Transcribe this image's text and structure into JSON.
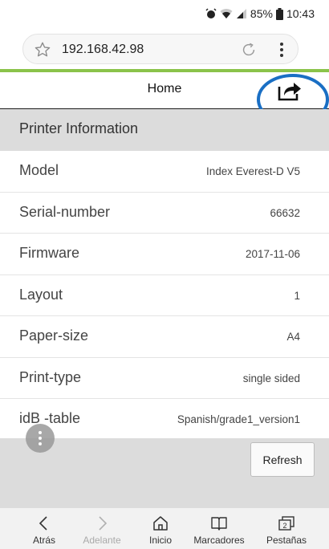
{
  "status_bar": {
    "battery": "85%",
    "time": "10:43"
  },
  "browser": {
    "url": "192.168.42.98"
  },
  "app_header": {
    "title": "Home"
  },
  "section": {
    "title": "Printer Information"
  },
  "printer_info": [
    {
      "label": "Model",
      "value": "Index Everest-D V5"
    },
    {
      "label": "Serial-number",
      "value": "66632"
    },
    {
      "label": "Firmware",
      "value": "2017-11-06"
    },
    {
      "label": "Layout",
      "value": "1"
    },
    {
      "label": "Paper-size",
      "value": "A4"
    },
    {
      "label": "Print-type",
      "value": "single sided"
    },
    {
      "label": "idB -table",
      "value": "Spanish/grade1_version1"
    }
  ],
  "refresh_label": "Refresh",
  "bottom_nav": [
    {
      "label": "Atrás",
      "icon": "back-arrow-icon"
    },
    {
      "label": "Adelante",
      "icon": "forward-arrow-icon"
    },
    {
      "label": "Inicio",
      "icon": "home-icon"
    },
    {
      "label": "Marcadores",
      "icon": "bookmarks-icon"
    },
    {
      "label": "Pestañas",
      "icon": "tabs-icon"
    }
  ],
  "colors": {
    "progress": "#8bc34a",
    "highlight_ring": "#1a6fc4",
    "section_bg": "#dcdcdc"
  }
}
